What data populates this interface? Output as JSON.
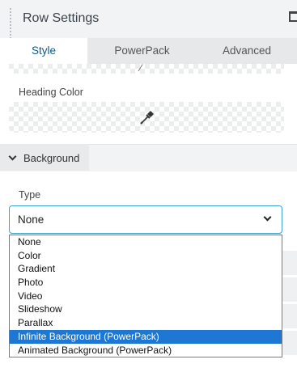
{
  "header": {
    "title": "Row Settings"
  },
  "tabs": [
    {
      "label": "Style",
      "active": true
    },
    {
      "label": "PowerPack",
      "active": false
    },
    {
      "label": "Advanced",
      "active": false
    }
  ],
  "heading_color": {
    "label": "Heading Color"
  },
  "background_section": {
    "title": "Background",
    "collapsed": false
  },
  "type_field": {
    "label": "Type",
    "value": "None",
    "options": [
      "None",
      "Color",
      "Gradient",
      "Photo",
      "Video",
      "Slideshow",
      "Parallax",
      "Infinite Background (PowerPack)",
      "Animated Background (PowerPack)"
    ],
    "highlighted": "Infinite Background (PowerPack)"
  },
  "colors": {
    "accent": "#3d9fd3",
    "active_tab_text": "#0e5a8a",
    "highlight": "#1e77d3"
  }
}
